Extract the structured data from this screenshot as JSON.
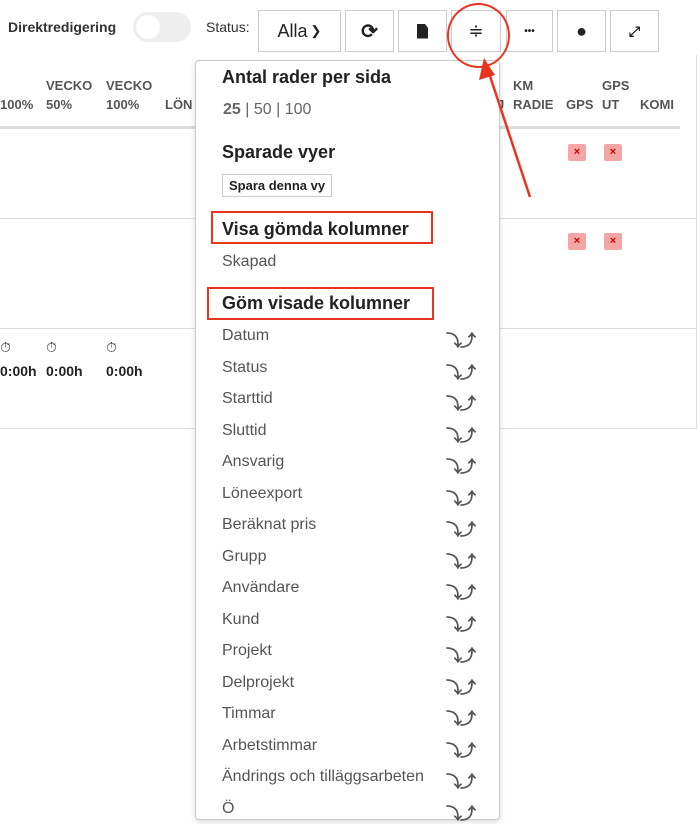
{
  "toolbar": {
    "direct_edit_label": "Direktredigering",
    "status_label": "Status:",
    "status_value": "Alla",
    "more_label": "•••"
  },
  "table": {
    "headers_left": [
      {
        "line1": "",
        "line2": "100%"
      },
      {
        "line1": "VECKO",
        "line2": "50%"
      },
      {
        "line1": "VECKO",
        "line2": "100%"
      },
      {
        "line1": "",
        "line2": "LÖN"
      }
    ],
    "headers_right": [
      {
        "line1": "",
        "line2": "J"
      },
      {
        "line1": "KM",
        "line2": "RADIE"
      },
      {
        "line1": "",
        "line2": "GPS"
      },
      {
        "line1": "GPS",
        "line2": "UT"
      },
      {
        "line1": "",
        "line2": "KOMI"
      }
    ],
    "badge": "×",
    "totals": [
      "0:00h",
      "0:00h",
      "0:00h"
    ]
  },
  "menu": {
    "rows_title": "Antal rader per sida",
    "rows_options": [
      "25",
      "50",
      "100"
    ],
    "sep": "|",
    "saved_title": "Sparade vyer",
    "save_button": "Spara denna vy",
    "show_hidden_title": "Visa gömda kolumner",
    "hidden_columns": [
      "Skapad"
    ],
    "hide_shown_title": "Göm visade kolumner",
    "shown_columns": [
      "Datum",
      "Status",
      "Starttid",
      "Sluttid",
      "Ansvarig",
      "Löneexport",
      "Beräknat pris",
      "Grupp",
      "Användare",
      "Kund",
      "Projekt",
      "Delprojekt",
      "Timmar",
      "Arbetstimmar",
      "Ändrings och tilläggsarbeten",
      "Ö"
    ],
    "move_arrows": "⤵⤴"
  }
}
